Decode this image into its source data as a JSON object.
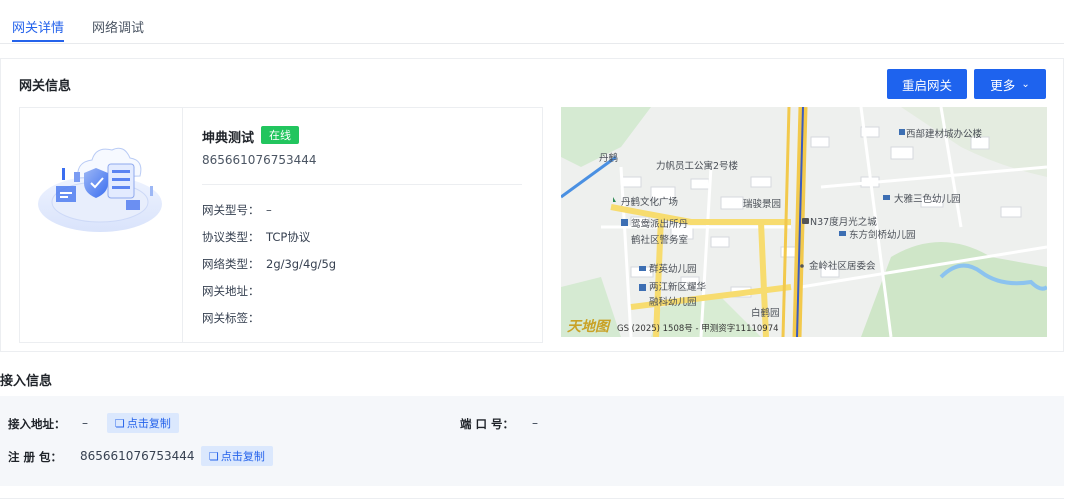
{
  "tabs": [
    {
      "label": "网关详情",
      "active": true
    },
    {
      "label": "网络调试",
      "active": false
    }
  ],
  "gateway": {
    "section_title": "网关信息",
    "restart_label": "重启网关",
    "more_label": "更多",
    "name": "坤典测试",
    "status": "在线",
    "id": "865661076753444",
    "fields": [
      {
        "label": "网关型号：",
        "value": "–"
      },
      {
        "label": "协议类型：",
        "value": "TCP协议"
      },
      {
        "label": "网络类型：",
        "value": "2g/3g/4g/5g"
      },
      {
        "label": "网关地址：",
        "value": ""
      },
      {
        "label": "网关标签：",
        "value": ""
      }
    ]
  },
  "map": {
    "labels": [
      "丹鹤",
      "力帆员工公寓2号楼",
      "西部建材城办公楼",
      "丹鹤文化广场",
      "瑞骏景园",
      "大雅三色幼儿园",
      "鸳鸯派出所丹",
      "鹤社区警务室",
      "N37度月光之城",
      "东方剑桥幼儿园",
      "群英幼儿园",
      "金岭社区居委会",
      "两江新区耀华",
      "融科幼儿园",
      "白鹤园"
    ],
    "watermark": "天地图",
    "copyright": "GS (2025) 1508号 - 甲测资字11110974"
  },
  "access": {
    "section_title": "接入信息",
    "address_label": "接入地址：",
    "address_value": "–",
    "port_label": "端 口 号：",
    "port_value": "–",
    "register_label": "注 册 包：",
    "register_value": "865661076753444",
    "copy_label": "点击复制"
  },
  "colors": {
    "primary": "#1e63ee",
    "online": "#22c55e",
    "tab_active": "#2563eb"
  }
}
